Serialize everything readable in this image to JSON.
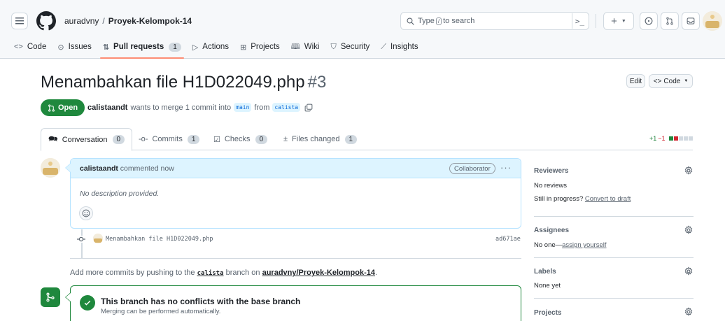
{
  "header": {
    "owner": "auradvny",
    "separator": "/",
    "repo": "Proyek-Kelompok-14",
    "search": {
      "prefix": "Type",
      "key": "/",
      "suffix": "to search"
    },
    "command_palette": ">_"
  },
  "reponav": [
    {
      "icon": "code-icon",
      "glyph": "<>",
      "label": "Code"
    },
    {
      "icon": "issue-icon",
      "glyph": "⊙",
      "label": "Issues"
    },
    {
      "icon": "pull-request-icon",
      "glyph": "⇅",
      "label": "Pull requests",
      "count": "1",
      "selected": true
    },
    {
      "icon": "play-icon",
      "glyph": "▷",
      "label": "Actions"
    },
    {
      "icon": "table-icon",
      "glyph": "⊞",
      "label": "Projects"
    },
    {
      "icon": "book-icon",
      "glyph": "🕮",
      "label": "Wiki"
    },
    {
      "icon": "shield-icon",
      "glyph": "⛉",
      "label": "Security"
    },
    {
      "icon": "graph-icon",
      "glyph": "⟋",
      "label": "Insights"
    }
  ],
  "pr": {
    "title": "Menambahkan file H1D022049.php",
    "number": "#3",
    "edit_label": "Edit",
    "code_label": "Code",
    "state": "Open",
    "author": "calistaandt",
    "merge_text": "wants to merge 1 commit into",
    "base_branch": "main",
    "from_word": "from",
    "head_branch": "calista"
  },
  "tabs": [
    {
      "label": "Conversation",
      "count": "0",
      "icon": "comment-discussion-icon"
    },
    {
      "label": "Commits",
      "count": "1",
      "icon": "git-commit-icon"
    },
    {
      "label": "Checks",
      "count": "0",
      "icon": "checklist-icon"
    },
    {
      "label": "Files changed",
      "count": "1",
      "icon": "file-diff-icon"
    }
  ],
  "diffstat": {
    "additions": "+1",
    "deletions": "−1"
  },
  "comment": {
    "author": "calistaandt",
    "action": "commented now",
    "role": "Collaborator",
    "body": "No description provided."
  },
  "commit": {
    "message": "Menambahkan file H1D022049.php",
    "sha": "ad671ae"
  },
  "add_more": {
    "prefix": "Add more commits by pushing to the",
    "branch": "calista",
    "middle": "branch on",
    "repo": "auradvny/Proyek-Kelompok-14",
    "suffix": "."
  },
  "merge_status": {
    "title": "This branch has no conflicts with the base branch",
    "subtitle": "Merging can be performed automatically."
  },
  "sidebar": {
    "reviewers": {
      "title": "Reviewers",
      "line1": "No reviews",
      "line2_prefix": "Still in progress?",
      "line2_link": "Convert to draft"
    },
    "assignees": {
      "title": "Assignees",
      "prefix": "No one—",
      "link": "assign yourself"
    },
    "labels": {
      "title": "Labels",
      "value": "None yet"
    },
    "projects": {
      "title": "Projects"
    }
  },
  "colors": {
    "open_green": "#1f883d",
    "accent_blue": "#0969da",
    "nav_underline": "#fd8c73",
    "deletion_red": "#d1242f"
  }
}
